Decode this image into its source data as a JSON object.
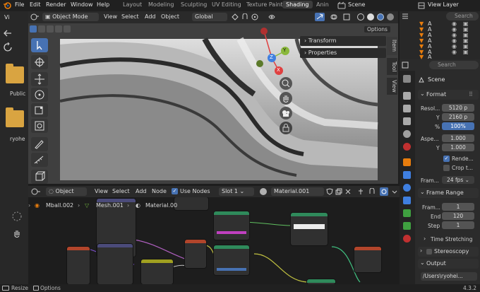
{
  "topbar": {
    "menus": [
      "File",
      "Edit",
      "Render",
      "Window",
      "Help"
    ],
    "workspaces": [
      "Layout",
      "Modeling",
      "Sculpting",
      "UV Editing",
      "Texture Paint",
      "Shading",
      "Anin"
    ],
    "active_workspace": "Shading",
    "scene": "Scene",
    "view_layer": "View Layer"
  },
  "file_browser": {
    "header": "Vi",
    "folders": [
      {
        "label": "Public"
      },
      {
        "label": "ryohe"
      }
    ]
  },
  "viewport": {
    "mode": "Object Mode",
    "menus": [
      "View",
      "Select",
      "Add",
      "Object"
    ],
    "orientation": "Global",
    "options_label": "Options",
    "npanel_sections": [
      "Transform",
      "Properties"
    ],
    "npanel_tabs": [
      "Item",
      "Tool",
      "View"
    ],
    "gizmo_axes": [
      "Z",
      "Y",
      "X"
    ]
  },
  "outliner": {
    "search_placeholder": "Search",
    "rows": [
      "A",
      "A",
      "A",
      "A",
      "A",
      "A",
      "A"
    ]
  },
  "properties": {
    "search_placeholder": "Search",
    "context": "Scene",
    "format": {
      "title": "Format",
      "resolution_label": "Resol...",
      "res_x": "5120 p",
      "y_label": "Y",
      "res_y": "2160 p",
      "pct_label": "%",
      "res_pct": "100%",
      "aspect_label": "Aspe...",
      "aspect_x": "1.000",
      "aspect_y": "1.000",
      "render_region": "Rende...",
      "crop": "Crop t...",
      "framerate_label": "Fram...",
      "framerate": "24 fps"
    },
    "frame_range": {
      "title": "Frame Range",
      "start_label": "Fram...",
      "start": "1",
      "end_label": "End",
      "end": "120",
      "step_label": "Step",
      "step": "1"
    },
    "time_stretching": "Time Stretching",
    "stereoscopy": "Stereoscopy",
    "output": {
      "title": "Output",
      "path": "/Users\\ryohei..."
    }
  },
  "node_editor": {
    "type": "Object",
    "menus": [
      "View",
      "Select",
      "Add",
      "Node"
    ],
    "use_nodes": "Use Nodes",
    "slot": "Slot 1",
    "material": "Material.001",
    "breadcrumb": [
      "Mball.002",
      "Mesh.001",
      "Material.00"
    ]
  },
  "statusbar": {
    "left": [
      "Resize",
      "Options"
    ],
    "version": "4.3.2"
  },
  "colors": {
    "accent": "#4772b3",
    "folder": "#d9a441",
    "axis_x": "#e04040",
    "axis_y": "#8ab83b",
    "axis_z": "#3f7fe0"
  }
}
